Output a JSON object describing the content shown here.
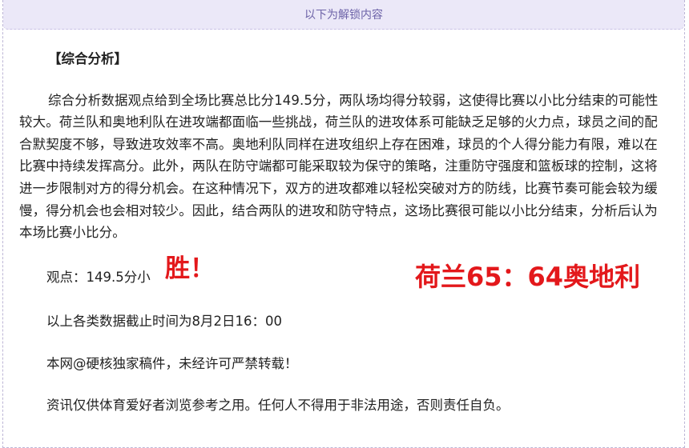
{
  "banner": {
    "text": "以下为解锁内容"
  },
  "article": {
    "heading": "【综合分析】",
    "paragraph": "综合分析数据观点给到全场比赛总比分149.5分，两队场均得分较弱，这使得比赛以小比分结束的可能性较大。荷兰队和奥地利队在进攻端都面临一些挑战，荷兰队的进攻体系可能缺乏足够的火力点，球员之间的配合默契度不够，导致进攻效率不高。奥地利队同样在进攻组织上存在困难，球员的个人得分能力有限，难以在比赛中持续发挥高分。此外，两队在防守端都可能采取较为保守的策略，注重防守强度和篮板球的控制，这将进一步限制对方的得分机会。在这种情况下，双方的进攻都难以轻松突破对方的防线，比赛节奏可能会较为缓慢，得分机会也会相对较少。因此，结合两队的进攻和防守特点，这场比赛很可能以小比分结束，分析后认为本场比赛小比分。",
    "viewpoint": "观点：149.5分小",
    "verdict": "胜！",
    "score": "荷兰65：64奥地利",
    "cutoff": "以上各类数据截止时间为8月2日16：00",
    "copyright": "本网@硬核独家稿件，未经许可严禁转载！",
    "disclaimer": "资讯仅供体育爱好者浏览参考之用。任何人不得用于非法用途，否则责任自负。"
  }
}
